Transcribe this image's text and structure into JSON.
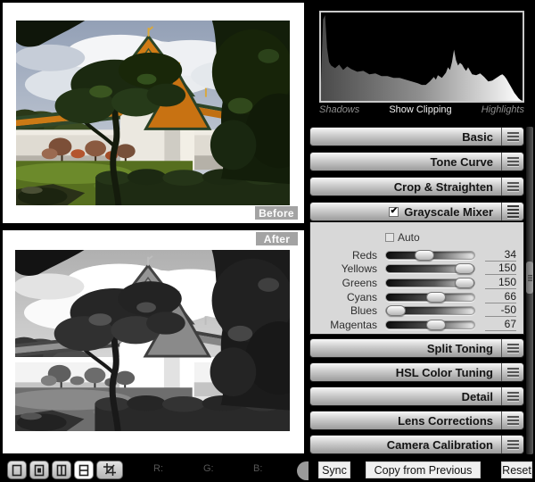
{
  "left": {
    "before_label": "Before",
    "after_label": "After",
    "toolbar": {
      "view_buttons": [
        {
          "name": "single-view",
          "icon": "square-icon",
          "active": false
        },
        {
          "name": "loupe-view",
          "icon": "square-filled-icon",
          "active": false
        },
        {
          "name": "before-after-side-by-side-view",
          "icon": "split-vertical-icon",
          "active": false
        },
        {
          "name": "before-after-top-bottom-view",
          "icon": "split-horizontal-icon",
          "active": true
        },
        {
          "name": "crop-tool",
          "icon": "crop-icon",
          "active": false
        }
      ],
      "r_label": "R:",
      "g_label": "G:",
      "b_label": "B:"
    }
  },
  "right": {
    "histogram": {
      "shadows_label": "Shadows",
      "clipping_label": "Show Clipping",
      "highlights_label": "Highlights",
      "fill_gradient": [
        "#4a4a4a",
        "#909090",
        "#ffffff"
      ],
      "points": [
        [
          0,
          20
        ],
        [
          1,
          92
        ],
        [
          2,
          97
        ],
        [
          3,
          60
        ],
        [
          4,
          44
        ],
        [
          5,
          40
        ],
        [
          7,
          37
        ],
        [
          9,
          41
        ],
        [
          11,
          35
        ],
        [
          13,
          39
        ],
        [
          15,
          36
        ],
        [
          18,
          33
        ],
        [
          21,
          34
        ],
        [
          24,
          30
        ],
        [
          27,
          31
        ],
        [
          30,
          28
        ],
        [
          33,
          28
        ],
        [
          36,
          26
        ],
        [
          39,
          26
        ],
        [
          42,
          24
        ],
        [
          45,
          22
        ],
        [
          48,
          20
        ],
        [
          50,
          18
        ],
        [
          52,
          18
        ],
        [
          54,
          22
        ],
        [
          56,
          27
        ],
        [
          57,
          24
        ],
        [
          58,
          29
        ],
        [
          60,
          26
        ],
        [
          62,
          32
        ],
        [
          63,
          38
        ],
        [
          64,
          35
        ],
        [
          65,
          44
        ],
        [
          66,
          58
        ],
        [
          67,
          46
        ],
        [
          68,
          40
        ],
        [
          69,
          43
        ],
        [
          70,
          41
        ],
        [
          71,
          37
        ],
        [
          72,
          34
        ],
        [
          73,
          38
        ],
        [
          74,
          34
        ],
        [
          75,
          30
        ],
        [
          77,
          29
        ],
        [
          79,
          31
        ],
        [
          81,
          27
        ],
        [
          83,
          22
        ],
        [
          85,
          23
        ],
        [
          87,
          26
        ],
        [
          89,
          29
        ],
        [
          90,
          30
        ],
        [
          91,
          28
        ],
        [
          92,
          25
        ],
        [
          93,
          21
        ],
        [
          94,
          17
        ],
        [
          95,
          13
        ],
        [
          96,
          9
        ],
        [
          97,
          6
        ],
        [
          98,
          3
        ],
        [
          99,
          1
        ],
        [
          100,
          0
        ]
      ]
    },
    "sections_top": [
      "Basic",
      "Tone Curve",
      "Crop & Straighten"
    ],
    "mixer": {
      "title": "Grayscale Mixer",
      "enabled": true,
      "auto_label": "Auto",
      "auto_checked": false,
      "range": {
        "min": -50,
        "max": 150
      },
      "sliders": [
        {
          "label": "Reds",
          "value": 34
        },
        {
          "label": "Yellows",
          "value": 150
        },
        {
          "label": "Greens",
          "value": 150
        },
        {
          "label": "Cyans",
          "value": 66
        },
        {
          "label": "Blues",
          "value": -50
        },
        {
          "label": "Magentas",
          "value": 67
        }
      ]
    },
    "sections_bottom": [
      "Split Toning",
      "HSL Color Tuning",
      "Detail",
      "Lens Corrections",
      "Camera Calibration"
    ],
    "footer_buttons": [
      "Sync",
      "Copy from Previous",
      "Reset"
    ]
  }
}
